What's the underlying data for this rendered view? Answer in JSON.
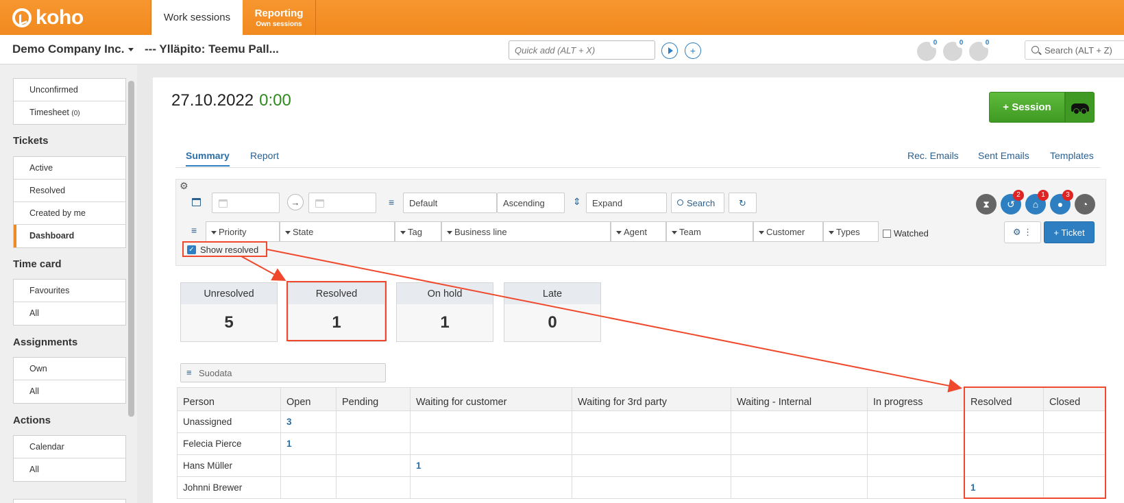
{
  "topbar": {
    "logo": "koho",
    "tabs": [
      {
        "label": "Work sessions",
        "sub": ""
      },
      {
        "label": "Reporting",
        "sub": "Own sessions"
      }
    ]
  },
  "subbar": {
    "company": "Demo Company Inc.",
    "maintenance": "--- Ylläpito: Teemu Pall...",
    "quick_add_placeholder": "Quick add (ALT + X)",
    "status_counts": [
      "0",
      "0",
      "0"
    ],
    "search_placeholder": "Search (ALT + Z)"
  },
  "sidebar": {
    "top_items": [
      "Unconfirmed",
      "Timesheet"
    ],
    "timesheet_count": "(0)",
    "sections": [
      {
        "title": "Tickets",
        "items": [
          "Active",
          "Resolved",
          "Created by me",
          "Dashboard"
        ]
      },
      {
        "title": "Time card",
        "items": [
          "Favourites",
          "All"
        ]
      },
      {
        "title": "Assignments",
        "items": [
          "Own",
          "All"
        ]
      },
      {
        "title": "Actions",
        "items": [
          "Calendar",
          "All"
        ]
      }
    ]
  },
  "main": {
    "date": "27.10.2022",
    "time": "0:00",
    "session_button": "+ Session",
    "tabs": [
      "Summary",
      "Report"
    ],
    "right_tabs": [
      "Rec. Emails",
      "Sent Emails",
      "Templates"
    ]
  },
  "filters": {
    "sort": "Default",
    "order": "Ascending",
    "expand": "Expand",
    "search_button": "Search",
    "dropdowns": [
      "Priority",
      "State",
      "Tag",
      "Business line",
      "Agent",
      "Team",
      "Customer",
      "Types"
    ],
    "watched": "Watched",
    "show_resolved": "Show resolved",
    "ticket_button": "+ Ticket",
    "badges": [
      "2",
      "1",
      "3"
    ]
  },
  "stats": [
    {
      "label": "Unresolved",
      "value": "5"
    },
    {
      "label": "Resolved",
      "value": "1"
    },
    {
      "label": "On hold",
      "value": "1"
    },
    {
      "label": "Late",
      "value": "0"
    }
  ],
  "table": {
    "filter_placeholder": "Suodata",
    "columns": [
      "Person",
      "Open",
      "Pending",
      "Waiting for customer",
      "Waiting for 3rd party",
      "Waiting - Internal",
      "In progress",
      "Resolved",
      "Closed"
    ],
    "rows": [
      [
        "Unassigned",
        "3",
        "",
        "",
        "",
        "",
        "",
        "",
        ""
      ],
      [
        "Felecia Pierce",
        "1",
        "",
        "",
        "",
        "",
        "",
        "",
        ""
      ],
      [
        "Hans Müller",
        "",
        "",
        "1",
        "",
        "",
        "",
        "",
        ""
      ],
      [
        "Johnni Brewer",
        "",
        "",
        "",
        "",
        "",
        "",
        "1",
        ""
      ]
    ]
  },
  "colors": {
    "brand": "#f18a1f",
    "accent": "#2d7fc1",
    "green": "#3f9a23",
    "highlight": "#f0482c"
  }
}
